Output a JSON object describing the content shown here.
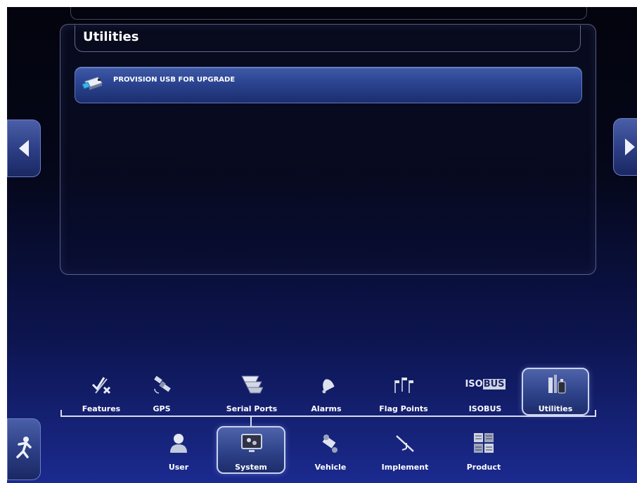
{
  "panel": {
    "title": "Utilities",
    "actions": [
      {
        "label": "PROVISION USB FOR UPGRADE",
        "icon": "usb-drive-icon"
      }
    ]
  },
  "nav": {
    "left_arrow_icon": "arrow-left-icon",
    "right_arrow_icon": "arrow-right-icon"
  },
  "setup_tabs": [
    {
      "label": "Features",
      "icon": "features-icon",
      "selected": false
    },
    {
      "label": "GPS",
      "icon": "satellite-icon",
      "selected": false
    },
    {
      "label": "Serial Ports",
      "icon": "serial-port-icon",
      "selected": false
    },
    {
      "label": "Alarms",
      "icon": "bell-icon",
      "selected": false
    },
    {
      "label": "Flag Points",
      "icon": "flags-icon",
      "selected": false
    },
    {
      "label": "ISOBUS",
      "icon": "isobus-icon",
      "selected": false,
      "icon_text_a": "ISO",
      "icon_text_b": "BUS"
    },
    {
      "label": "Utilities",
      "icon": "tools-icon",
      "selected": true
    }
  ],
  "category_tabs": [
    {
      "label": "User",
      "icon": "user-icon",
      "selected": false
    },
    {
      "label": "System",
      "icon": "system-display-icon",
      "selected": true
    },
    {
      "label": "Vehicle",
      "icon": "vehicle-icon",
      "selected": false
    },
    {
      "label": "Implement",
      "icon": "implement-icon",
      "selected": false
    },
    {
      "label": "Product",
      "icon": "product-icon",
      "selected": false
    }
  ],
  "exit": {
    "icon": "exit-running-man-icon"
  }
}
